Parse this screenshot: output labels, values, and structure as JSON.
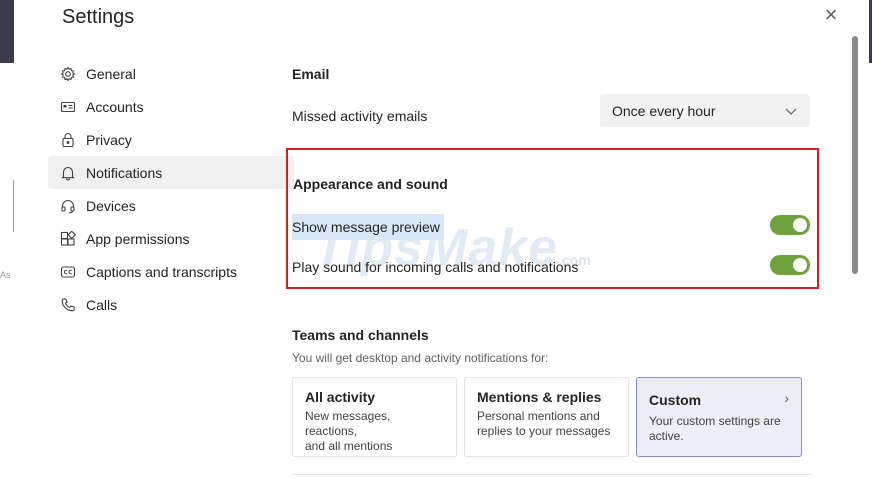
{
  "dialog": {
    "title": "Settings"
  },
  "nav": {
    "items": [
      {
        "label": "General",
        "icon": "gear-icon"
      },
      {
        "label": "Accounts",
        "icon": "id-card-icon"
      },
      {
        "label": "Privacy",
        "icon": "lock-icon"
      },
      {
        "label": "Notifications",
        "icon": "bell-icon",
        "active": true
      },
      {
        "label": "Devices",
        "icon": "headset-icon"
      },
      {
        "label": "App permissions",
        "icon": "apps-icon"
      },
      {
        "label": "Captions and transcripts",
        "icon": "cc-icon"
      },
      {
        "label": "Calls",
        "icon": "phone-icon"
      }
    ]
  },
  "email": {
    "title": "Email",
    "missed_label": "Missed activity emails",
    "missed_value": "Once every hour"
  },
  "appearance": {
    "title": "Appearance and sound",
    "preview_label": "Show message preview",
    "preview_on": true,
    "sound_label": "Play sound for incoming calls and notifications",
    "sound_on": true
  },
  "teams": {
    "title": "Teams and channels",
    "subtitle": "You will get desktop and activity notifications for:",
    "cards": [
      {
        "title": "All activity",
        "desc1": "New messages, reactions,",
        "desc2": "and all mentions"
      },
      {
        "title": "Mentions & replies",
        "desc1": "Personal mentions and",
        "desc2": "replies to your messages"
      },
      {
        "title": "Custom",
        "desc1": "Your custom settings are",
        "desc2": "active.",
        "selected": true
      }
    ]
  },
  "watermark": {
    "text": "TipsMake",
    "suffix": ".com"
  },
  "background": {
    "fragment": "As"
  },
  "colors": {
    "toggle_on": "#6fa23c",
    "highlight_border": "#d32028",
    "selected_card": "#edeef7"
  }
}
